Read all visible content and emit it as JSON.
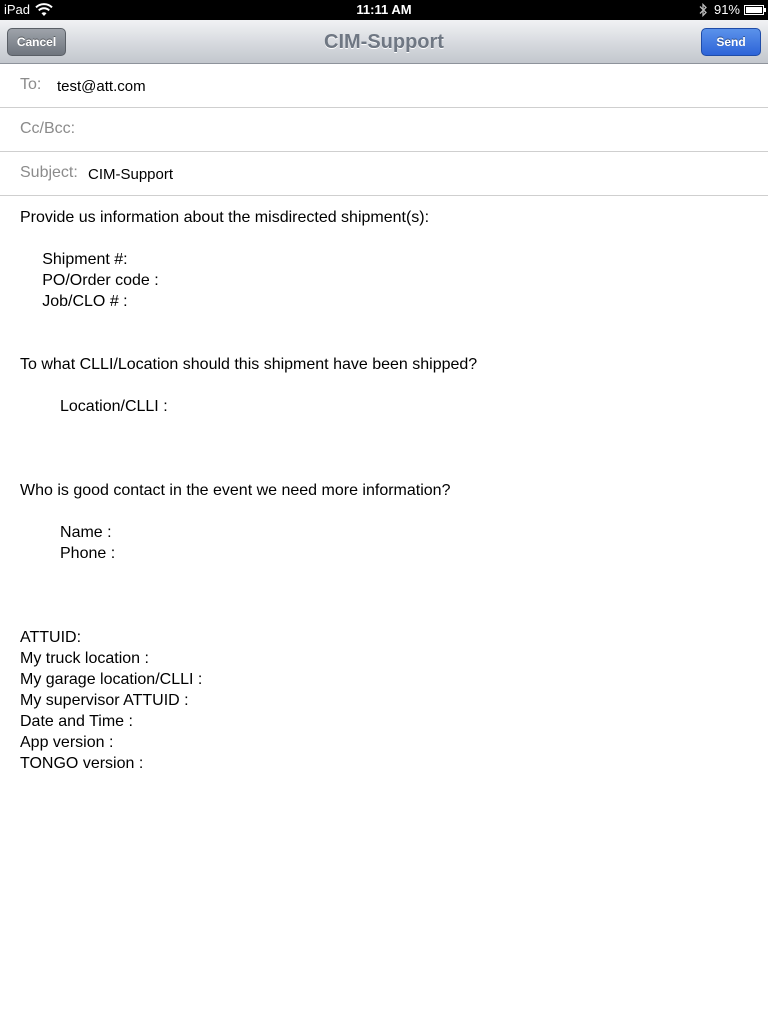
{
  "status_bar": {
    "carrier": "iPad",
    "time": "11:11 AM",
    "battery_percent": "91%",
    "battery_level": 0.91
  },
  "nav": {
    "title": "CIM-Support",
    "cancel_label": "Cancel",
    "send_label": "Send"
  },
  "fields": {
    "to_label": "To:",
    "to_value": "test@att.com",
    "cc_label": "Cc/Bcc:",
    "subject_label": "Subject:",
    "subject_value": "CIM-Support"
  },
  "body_lines": [
    "Provide us information about the misdirected shipment(s):",
    "",
    "     Shipment #:",
    "     PO/Order code :",
    "     Job/CLO # :",
    "",
    "",
    "To what CLLI/Location should this shipment have been shipped?",
    "",
    "         Location/CLLI :",
    "",
    "",
    "",
    "Who is good contact in the event we need more information?",
    "",
    "         Name :",
    "         Phone :",
    "",
    "",
    "",
    "ATTUID:",
    "My truck location :",
    "My garage location/CLLI :",
    "My supervisor ATTUID :",
    "Date and Time :",
    "App version :",
    "TONGO version :"
  ]
}
